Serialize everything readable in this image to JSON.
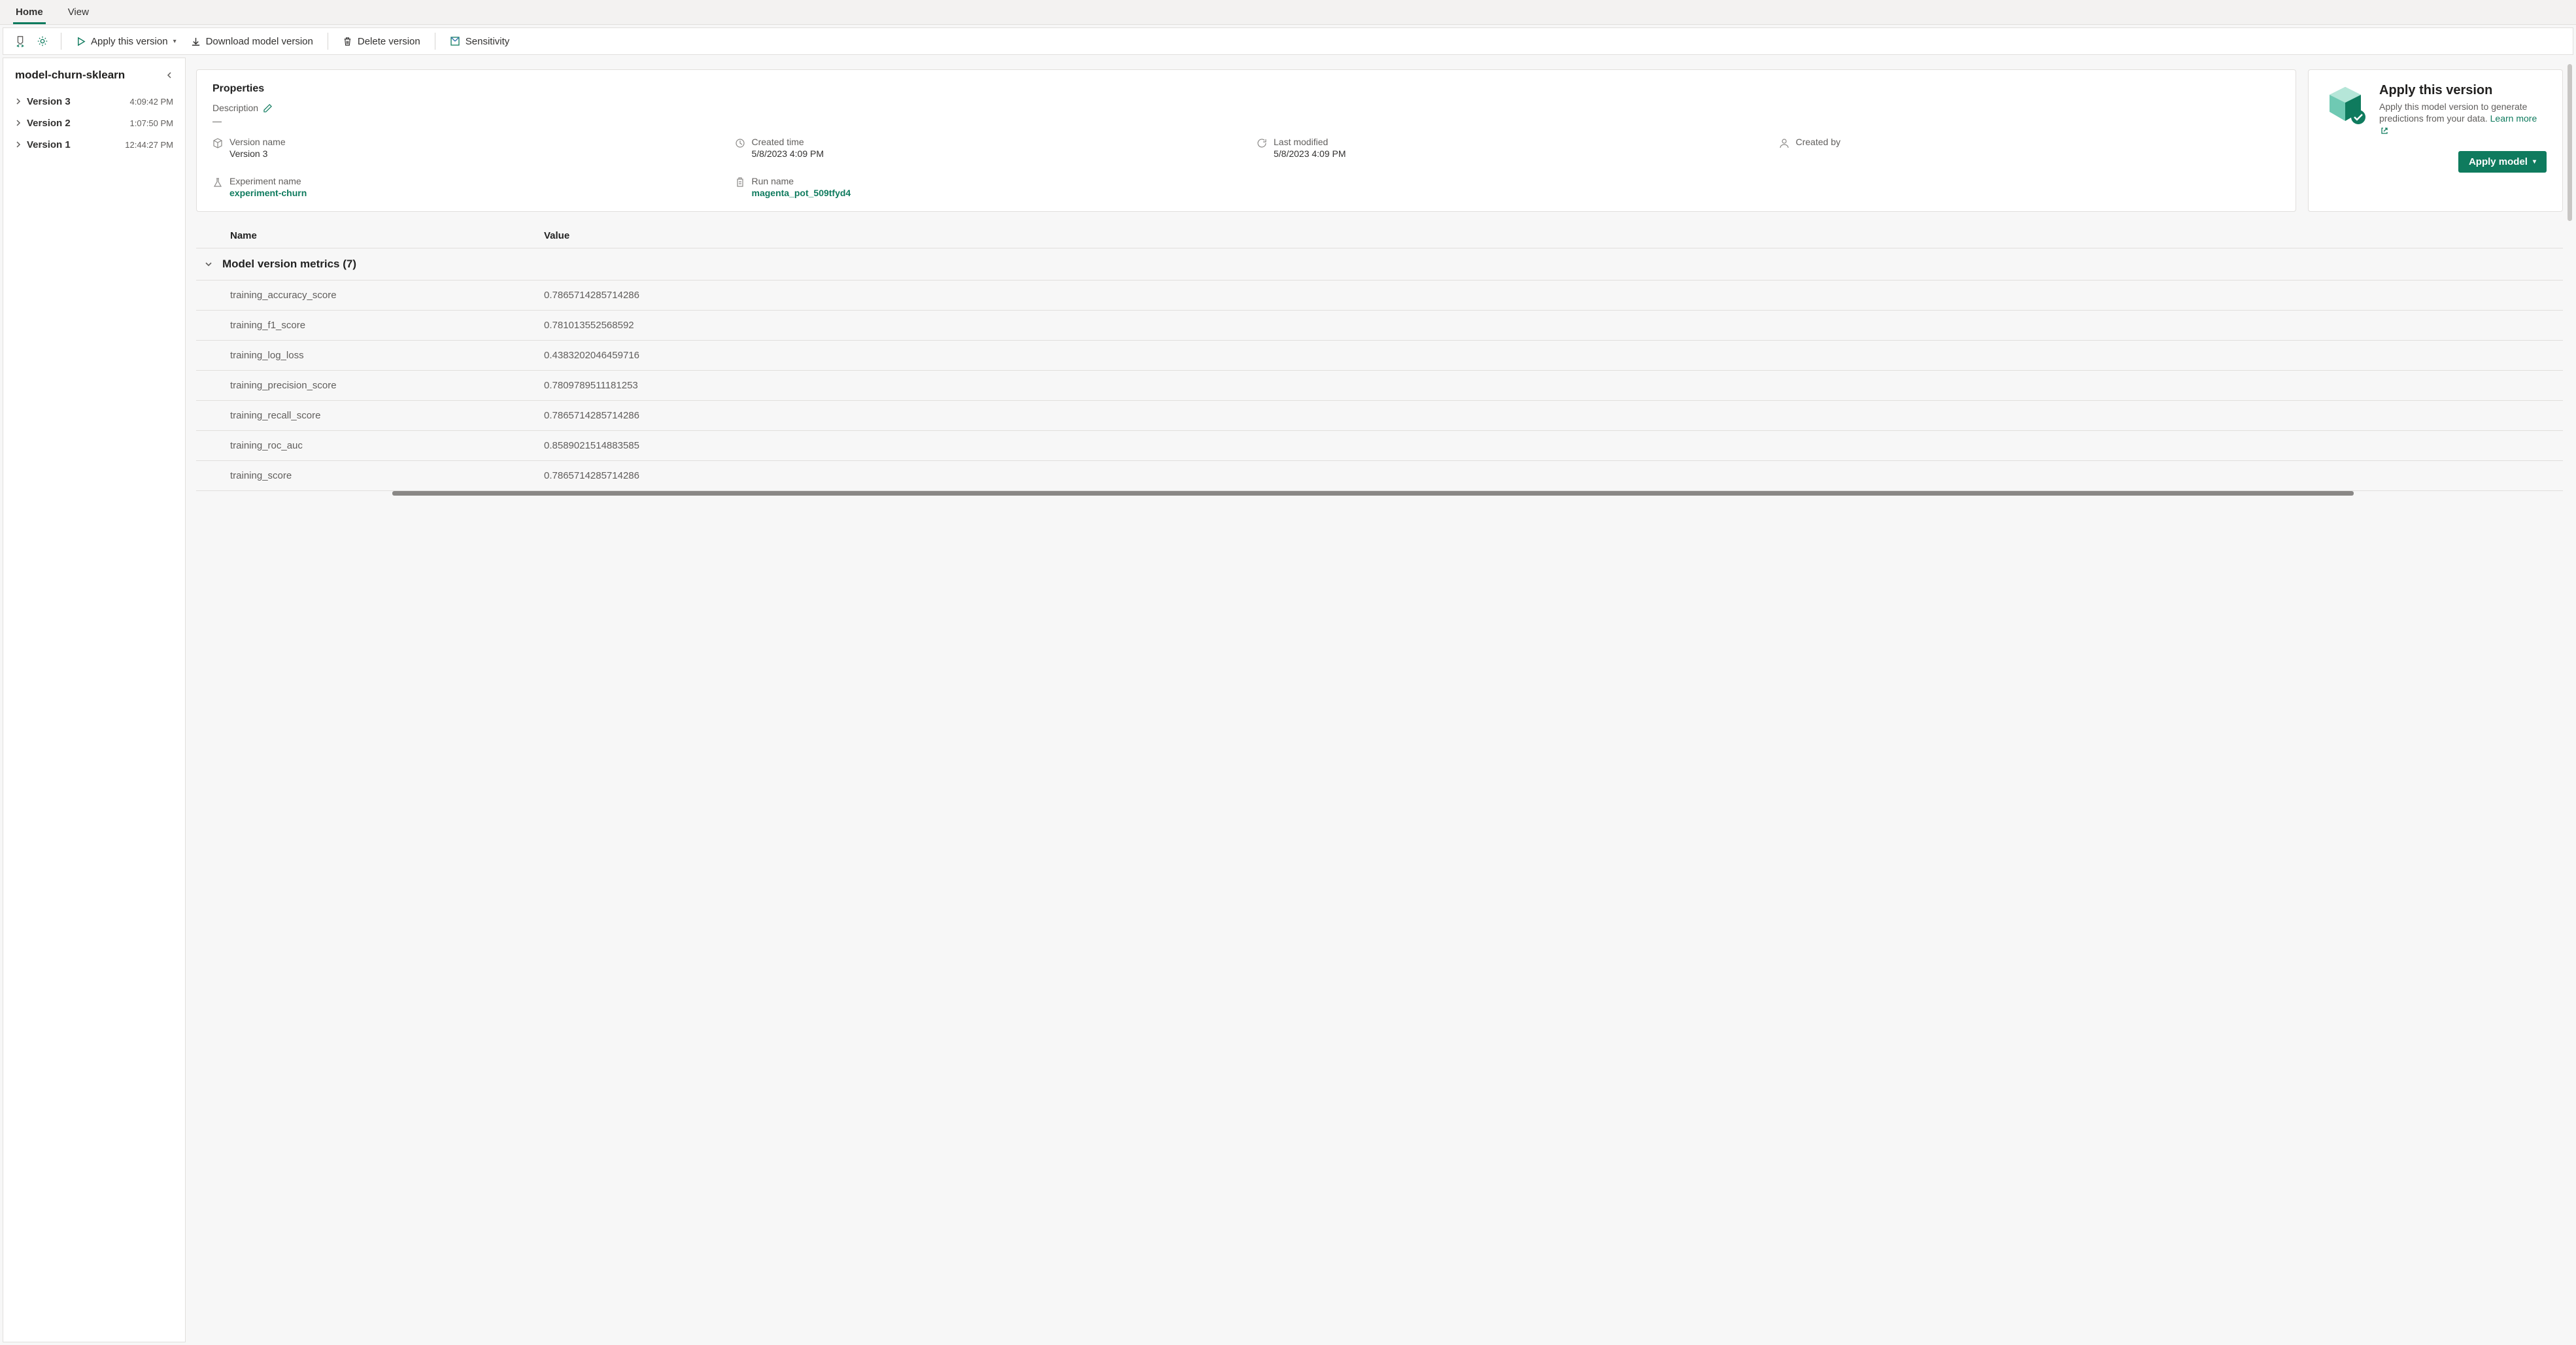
{
  "tabs": {
    "home": "Home",
    "view": "View"
  },
  "toolbar": {
    "apply": "Apply this version",
    "download": "Download model version",
    "delete": "Delete version",
    "sensitivity": "Sensitivity"
  },
  "sidebar": {
    "title": "model-churn-sklearn",
    "versions": [
      {
        "name": "Version 3",
        "time": "4:09:42 PM"
      },
      {
        "name": "Version 2",
        "time": "1:07:50 PM"
      },
      {
        "name": "Version 1",
        "time": "12:44:27 PM"
      }
    ]
  },
  "properties": {
    "title": "Properties",
    "description_label": "Description",
    "description_value": "—",
    "fields": {
      "version_name": {
        "label": "Version name",
        "value": "Version 3"
      },
      "created_time": {
        "label": "Created time",
        "value": "5/8/2023 4:09 PM"
      },
      "last_modified": {
        "label": "Last modified",
        "value": "5/8/2023 4:09 PM"
      },
      "created_by": {
        "label": "Created by",
        "value": ""
      },
      "experiment_name": {
        "label": "Experiment name",
        "value": "experiment-churn"
      },
      "run_name": {
        "label": "Run name",
        "value": "magenta_pot_509tfyd4"
      }
    }
  },
  "apply": {
    "title": "Apply this version",
    "text": "Apply this model version to generate predictions from your data.",
    "learn": "Learn more",
    "button": "Apply model"
  },
  "metrics": {
    "header_name": "Name",
    "header_value": "Value",
    "group_title": "Model version metrics (7)",
    "rows": [
      {
        "name": "training_accuracy_score",
        "value": "0.7865714285714286"
      },
      {
        "name": "training_f1_score",
        "value": "0.781013552568592"
      },
      {
        "name": "training_log_loss",
        "value": "0.4383202046459716"
      },
      {
        "name": "training_precision_score",
        "value": "0.7809789511181253"
      },
      {
        "name": "training_recall_score",
        "value": "0.7865714285714286"
      },
      {
        "name": "training_roc_auc",
        "value": "0.8589021514883585"
      },
      {
        "name": "training_score",
        "value": "0.7865714285714286"
      }
    ]
  }
}
